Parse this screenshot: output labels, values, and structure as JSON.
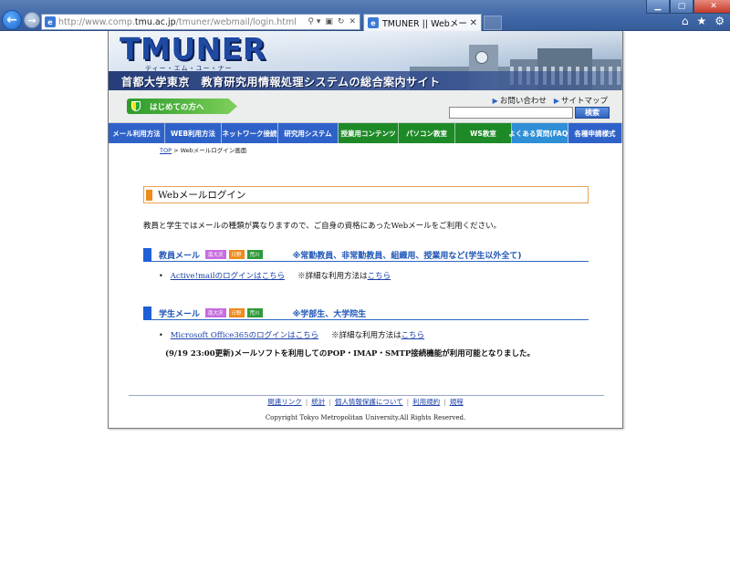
{
  "browser": {
    "url_prefix": "http://www.comp.",
    "url_domain": "tmu.ac.jp",
    "url_path": "/tmuner/webmail/login.html",
    "tab_title": "TMUNER || Webメー...",
    "tab_close": "✕",
    "addr_icons": [
      "⚲ ▾",
      "▣",
      "↻",
      "✕"
    ],
    "nav_back": "←",
    "nav_forward": "→",
    "win_min": "▁",
    "win_max": "▢",
    "win_close": "✕",
    "tool_icons": [
      "⌂",
      "★",
      "⚙"
    ]
  },
  "header": {
    "logo": "TMUNER",
    "logo_kana": "ティー・エム・ユー・ナー",
    "subtitle": "首都大学東京　教育研究用情報処理システムの総合案内サイト",
    "beginner_label": "はじめての方へ",
    "links": [
      "お問い合わせ",
      "サイトマップ"
    ],
    "search_button": "検索",
    "search_placeholder": ""
  },
  "nav": [
    {
      "label": "メール利用方法",
      "color": "#2f62c9"
    },
    {
      "label": "WEB利用方法",
      "color": "#2f62c9"
    },
    {
      "label": "ネットワーク接続",
      "color": "#2f62c9"
    },
    {
      "label": "研究用システム",
      "color": "#2f62c9"
    },
    {
      "label": "授業用コンテンツ",
      "color": "#1d8a27"
    },
    {
      "label": "パソコン教室",
      "color": "#1d8a27"
    },
    {
      "label": "WS教室",
      "color": "#1d8a27"
    },
    {
      "label": "よくある質問(FAQ)",
      "color": "#2f8fd6"
    },
    {
      "label": "各種申請様式",
      "color": "#2f62c9"
    }
  ],
  "breadcrumb": {
    "top_link": "TOP",
    "rest": " > Webメールログイン画面"
  },
  "content": {
    "title": "Webメールログイン",
    "intro": "教員と学生ではメールの種類が異なりますので、ご自身の資格にあったWebメールをご利用ください。",
    "sections": [
      {
        "name": "教員メール",
        "badges": [
          {
            "label": "南大沢",
            "color": "#c86ce0"
          },
          {
            "label": "日野",
            "color": "#f08a1c"
          },
          {
            "label": "荒川",
            "color": "#2e9a3a"
          }
        ],
        "note": "※常勤教員、非常勤教員、組織用、授業用など(学生以外全て)",
        "link": "Active!mailのログインはこちら",
        "detail_prefix": "※詳細な利用方法は",
        "detail_link": "こちら"
      },
      {
        "name": "学生メール",
        "badges": [
          {
            "label": "南大沢",
            "color": "#c86ce0"
          },
          {
            "label": "日野",
            "color": "#f08a1c"
          },
          {
            "label": "荒川",
            "color": "#2e9a3a"
          }
        ],
        "note": "※学部生、大学院生",
        "link": "Microsoft Office365のログインはこちら",
        "detail_prefix": "※詳細な利用方法は",
        "detail_link": "こちら"
      }
    ],
    "notice": "(9/19 23:00更新)メールソフトを利用してのPOP・IMAP・SMTP接続機能が利用可能となりました。"
  },
  "footer": {
    "links": [
      "関連リンク",
      "統計",
      "個人情報保護について",
      "利用規約",
      "規程"
    ],
    "separator": "|",
    "copyright": "Copyright Tokyo Metropolitan University.All Rights Reserved."
  },
  "colors": {
    "chrome": "#3f67a6",
    "link": "#1a3fa8",
    "section_blue": "#1f56b8",
    "title_orange": "#f08a1c"
  }
}
